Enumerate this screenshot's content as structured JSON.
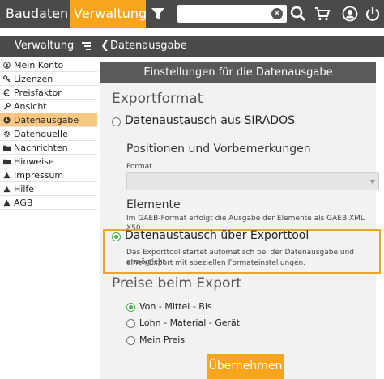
{
  "topbar": {
    "tabs": [
      {
        "label": "Baudaten"
      },
      {
        "label": "Verwaltung"
      }
    ],
    "search": {
      "value": "",
      "placeholder": ""
    }
  },
  "sidebar": {
    "title": "Verwaltung",
    "items": [
      {
        "label": "Mein Konto",
        "icon": "user-circle-icon"
      },
      {
        "label": "Lizenzen",
        "icon": "key-icon"
      },
      {
        "label": "Preisfaktor",
        "icon": "euro-icon"
      },
      {
        "label": "Ansicht",
        "icon": "wrench-icon"
      },
      {
        "label": "Datenausgabe",
        "icon": "export-icon",
        "active": true
      },
      {
        "label": "Datenquelle",
        "icon": "gear-icon"
      },
      {
        "label": "Nachrichten",
        "icon": "folder-icon"
      },
      {
        "label": "Hinweise",
        "icon": "folder-icon"
      },
      {
        "label": "Impressum",
        "icon": "triangle-icon"
      },
      {
        "label": "Hilfe",
        "icon": "triangle-icon"
      },
      {
        "label": "AGB",
        "icon": "triangle-icon"
      }
    ]
  },
  "content": {
    "header": "Datenausgabe",
    "panel_title": "Einstellungen für die Datenausgabe",
    "exportformat_heading": "Exportformat",
    "option_sirados": "Datenaustausch aus SIRADOS",
    "positions_heading": "Positionen und Vorbemerkungen",
    "format_label": "Format",
    "format_value": "",
    "elemente_heading": "Elemente",
    "elemente_note": "Im GAEB-Format erfolgt die Ausgabe der Elemente als GAEB XML X50.",
    "option_exporttool": "Datenaustausch über Exporttool",
    "exporttool_note_line1": "Das Exporttool startet automatisch bei der Datenausgabe und ermöglicht",
    "exporttool_note_line2": "einen Export mit speziellen Formateinstellungen.",
    "preise_heading": "Preise beim Export",
    "price_options": [
      {
        "label": "Von - Mittel - Bis",
        "checked": true
      },
      {
        "label": "Lohn - Material - Gerät",
        "checked": false
      },
      {
        "label": "Mein Preis",
        "checked": false
      }
    ],
    "submit_label": "Übernehmen"
  },
  "colors": {
    "accent": "#f7a51d",
    "bar": "#4a4a4a",
    "radio_checked": "#4caf50",
    "highlight_border": "#e7a72d"
  }
}
